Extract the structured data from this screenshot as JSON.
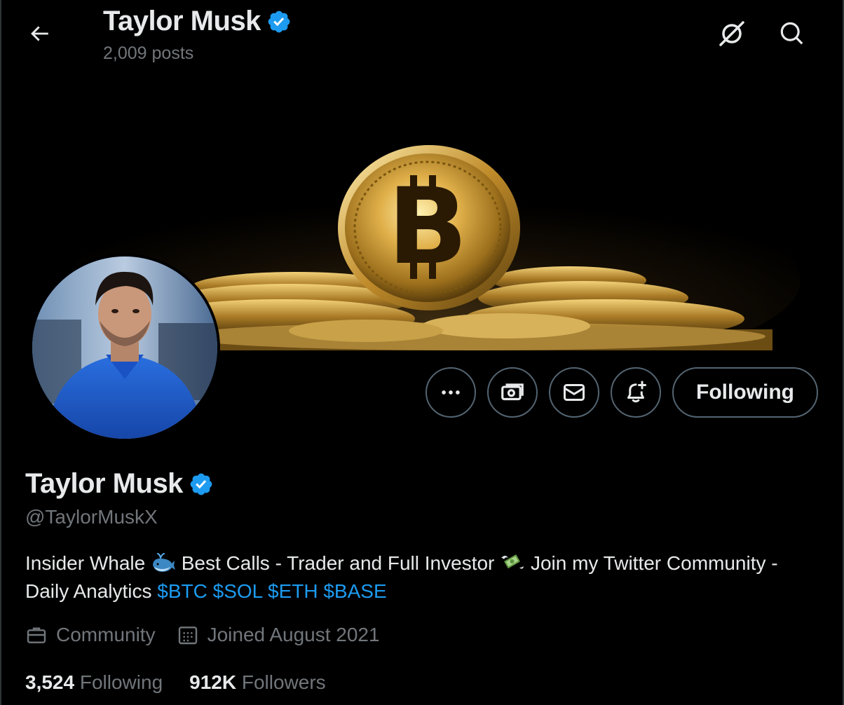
{
  "header": {
    "name": "Taylor Musk",
    "posts_count": "2,009 posts"
  },
  "profile": {
    "name": "Taylor Musk",
    "handle": "@TaylorMuskX",
    "bio_part1": "Insider Whale",
    "bio_part2": "Best Calls - Trader and Full Investor",
    "bio_part3": "Join my Twitter Community - Daily Analytics",
    "cashtags": [
      "$BTC",
      "$SOL",
      "$ETH",
      "$BASE"
    ],
    "category": "Community",
    "joined": "Joined August 2021",
    "following_count": "3,524",
    "following_label": "Following",
    "followers_count": "912K",
    "followers_label": "Followers"
  },
  "actions": {
    "following_button": "Following"
  },
  "icons": {
    "back": "arrow-left-icon",
    "grok": "grok-icon",
    "search": "search-icon",
    "more": "more-dots-icon",
    "subscribe": "money-icon",
    "message": "envelope-icon",
    "notify": "bell-plus-icon",
    "verified": "verified-badge-icon",
    "category": "briefcase-icon",
    "joined": "calendar-icon"
  },
  "colors": {
    "accent": "#1d9bf0",
    "text": "#e7e9ea",
    "muted": "#71767b",
    "border": "#536471"
  }
}
